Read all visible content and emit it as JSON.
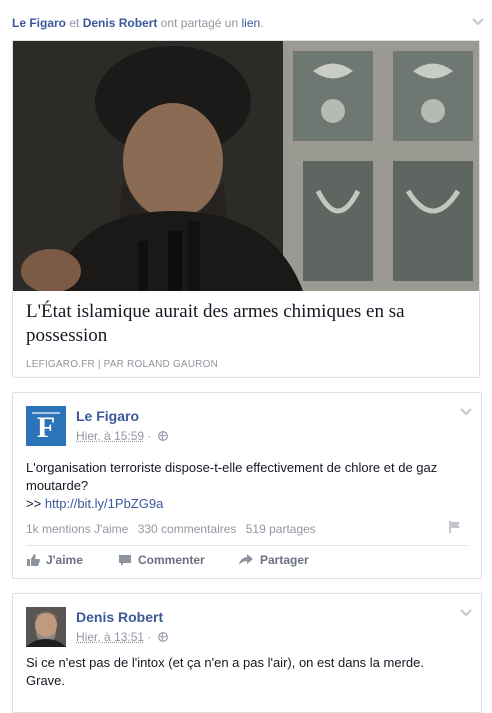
{
  "header": {
    "name1": "Le Figaro",
    "connector": "et",
    "name2": "Denis Robert",
    "verb": "ont partagé un",
    "link_word": "lien",
    "period": "."
  },
  "link_card": {
    "title": "L'État islamique aurait des armes chimiques en sa possession",
    "source": "LEFIGARO.FR",
    "separator": "|",
    "byline": "PAR ROLAND GAURON"
  },
  "post1": {
    "author": "Le Figaro",
    "time": "Hier, à 15:59",
    "meta_sep": "·",
    "text": "L'organisation terroriste dispose-t-elle effectivement de chlore et de gaz moutarde?",
    "link_prefix": ">>",
    "link": "http://bit.ly/1PbZG9a",
    "likes": "1k mentions J'aime",
    "comments": "330 commentaires",
    "shares": "519 partages",
    "actions": {
      "like": "J'aime",
      "comment": "Commenter",
      "share": "Partager"
    }
  },
  "post2": {
    "author": "Denis Robert",
    "time": "Hier, à 13:51",
    "meta_sep": "·",
    "text": "Si ce n'est pas de l'intox (et ça n'en a pas l'air), on est dans la merde. Grave."
  },
  "colors": {
    "facebook_blue": "#3b5998",
    "muted": "#9197a3",
    "border": "#dddfe2"
  },
  "icons": [
    "chevron-down-icon",
    "globe-icon",
    "flag-icon",
    "thumbs-up-icon",
    "comment-icon",
    "share-icon"
  ]
}
